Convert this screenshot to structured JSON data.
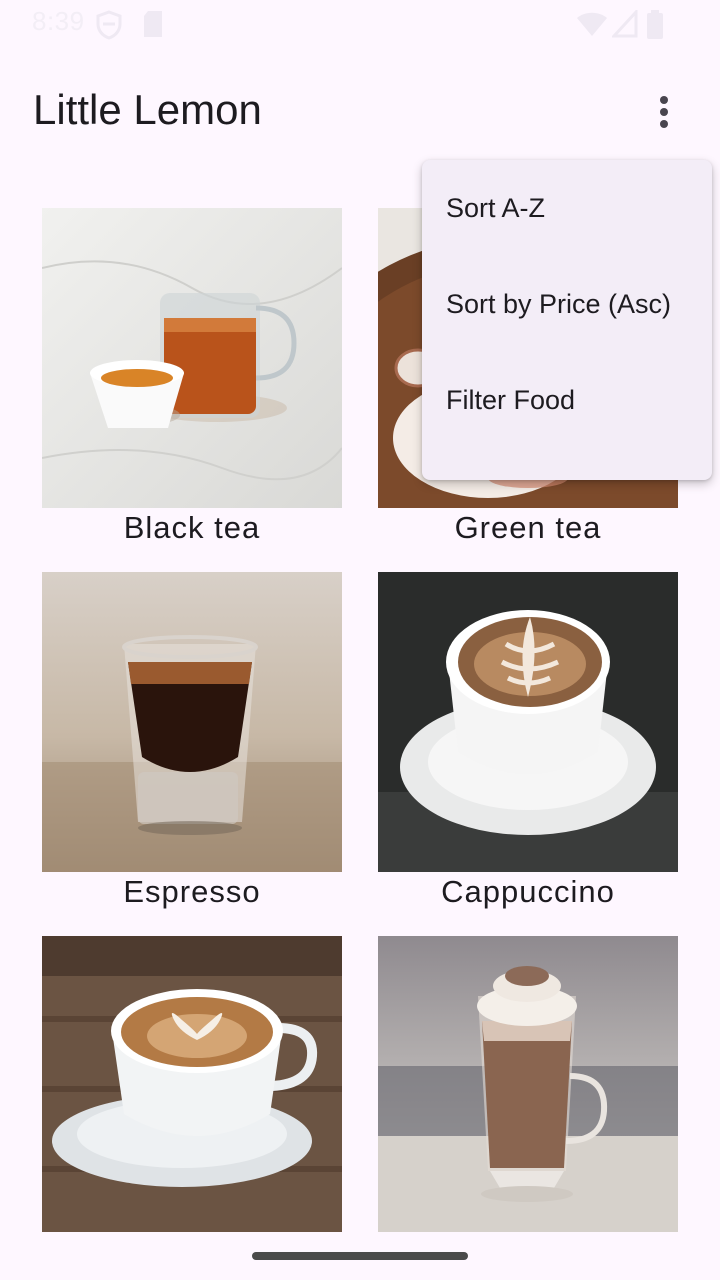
{
  "status_bar": {
    "time": "8:39",
    "icons": [
      "shield-icon",
      "sim-card-icon",
      "wifi-icon",
      "signal-icon",
      "battery-icon"
    ]
  },
  "app_bar": {
    "title": "Little Lemon",
    "overflow_icon": "more-vert-icon"
  },
  "menu": {
    "items": [
      {
        "label": "Sort A-Z"
      },
      {
        "label": "Sort by Price (Asc)"
      },
      {
        "label": "Filter Food"
      }
    ]
  },
  "grid": {
    "items": [
      {
        "name": "Black tea"
      },
      {
        "name": "Green tea"
      },
      {
        "name": "Espresso"
      },
      {
        "name": "Cappuccino"
      },
      {
        "name": ""
      },
      {
        "name": ""
      }
    ]
  },
  "colors": {
    "background": "#FEF7FF",
    "menu_surface": "#F3EDF7",
    "text": "#1D1B20"
  }
}
